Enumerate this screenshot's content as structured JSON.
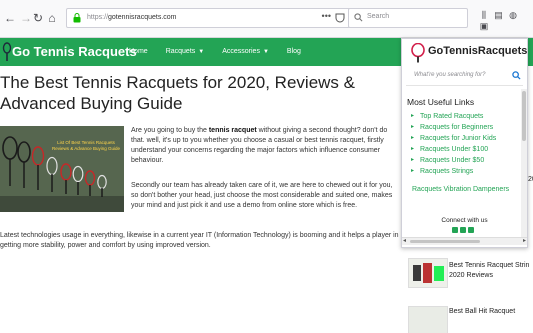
{
  "browser": {
    "url_prefix": "https://",
    "url_domain": "gotennisracquets.com",
    "search_placeholder": "Search",
    "more_dots": "•••"
  },
  "header": {
    "site_title": "Go Tennis Racquets",
    "nav": [
      {
        "label": "Home"
      },
      {
        "label": "Racquets",
        "has_menu": true
      },
      {
        "label": "Accessories",
        "has_menu": true
      },
      {
        "label": "Blog"
      }
    ],
    "bg_color": "#23a455"
  },
  "article": {
    "title": "The Best Tennis Racquets for 2020, Reviews & Advanced Buying Guide",
    "hero_caption": "List Of Best Tennis Racquets Reviews & Advance Buying Guide",
    "para1_a": "Are you going to buy the ",
    "para1_bold": "tennis racquet",
    "para1_b": " without giving a second thought? don't do that. well, it's up to you whether you choose a casual or best tennis racquet, firstly understand your concerns regarding the major factors which influence consumer behaviour.",
    "para2": "Secondly our team has already taken care of it, we are here to chewed out it for you, so don't bother your head, just choose the most considerable and suited one,  makes your mind and just pick it and use a demo from online store which is free.",
    "para3": "Latest technologies usage in everything, likewise in a current year IT (Information Technology) is booming and it helps a player in getting more stability, power and comfort by using improved version."
  },
  "popup": {
    "brand": "GoTennisRacquets",
    "search_placeholder": "What're you searching for?",
    "links_title": "Most Useful Links",
    "links": [
      "Top Rated Racquets",
      "Racquets for Beginners",
      "Racquets for Junior Kids",
      "Racquets Under $100",
      "Racquets Under $50",
      "Racquets Strings"
    ],
    "vibration": "Racquets Vibration Dampeners",
    "connect": "Connect with us"
  },
  "sidebar": {
    "year_fragment": "20",
    "posts": [
      {
        "title_line1": "Best Tennis Racquet Strin",
        "title_line2": "2020 Reviews"
      },
      {
        "title_line1": "Best Ball Hit Racquet",
        "title_line2": ""
      }
    ]
  }
}
